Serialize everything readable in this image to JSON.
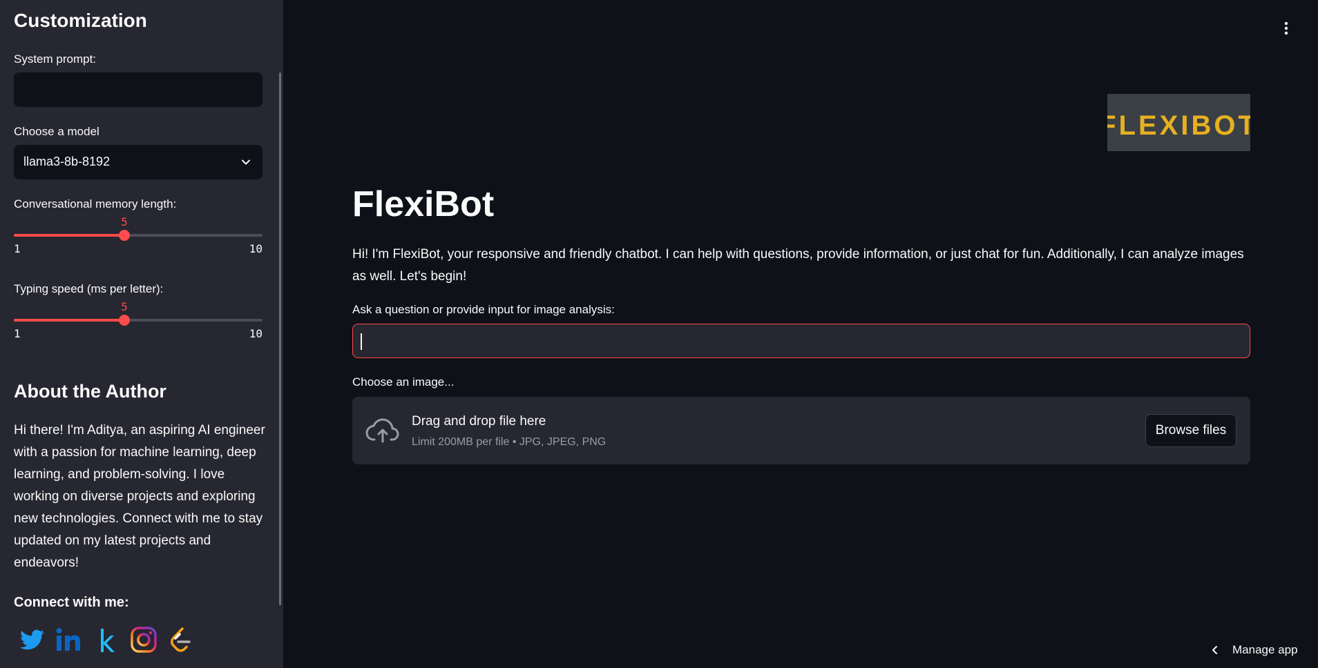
{
  "sidebar": {
    "title": "Customization",
    "system_prompt_label": "System prompt:",
    "system_prompt_value": "",
    "model_label": "Choose a model",
    "model_value": "llama3-8b-8192",
    "memory_slider": {
      "label": "Conversational memory length:",
      "value": "5",
      "min": "1",
      "max": "10",
      "fraction": 0.444
    },
    "speed_slider": {
      "label": "Typing speed (ms per letter):",
      "value": "5",
      "min": "1",
      "max": "10",
      "fraction": 0.444
    },
    "about_title": "About the Author",
    "about_text": "Hi there! I'm Aditya, an aspiring AI engineer with a passion for machine learning, deep learning, and problem-solving. I love working on diverse projects and exploring new technologies. Connect with me to stay updated on my latest projects and endeavors!",
    "connect_title": "Connect with me:",
    "socials": [
      "twitter-icon",
      "linkedin-icon",
      "kaggle-icon",
      "instagram-icon",
      "leetcode-icon"
    ]
  },
  "main": {
    "logo_text": "FLEXIBOT",
    "title": "FlexiBot",
    "intro": "Hi! I'm FlexiBot, your responsive and friendly chatbot. I can help with questions, provide information, or just chat for fun. Additionally, I can analyze images as well. Let's begin!",
    "input_label": "Ask a question or provide input for image analysis:",
    "input_value": "",
    "image_label": "Choose an image...",
    "dropzone_title": "Drag and drop file here",
    "dropzone_sub": "Limit 200MB per file • JPG, JPEG, PNG",
    "browse_label": "Browse files"
  },
  "footer": {
    "manage_label": "Manage app"
  },
  "colors": {
    "accent": "#ff4b4b",
    "background": "#0e1117",
    "sidebar": "#262730",
    "logo_text": "#e8b020"
  }
}
